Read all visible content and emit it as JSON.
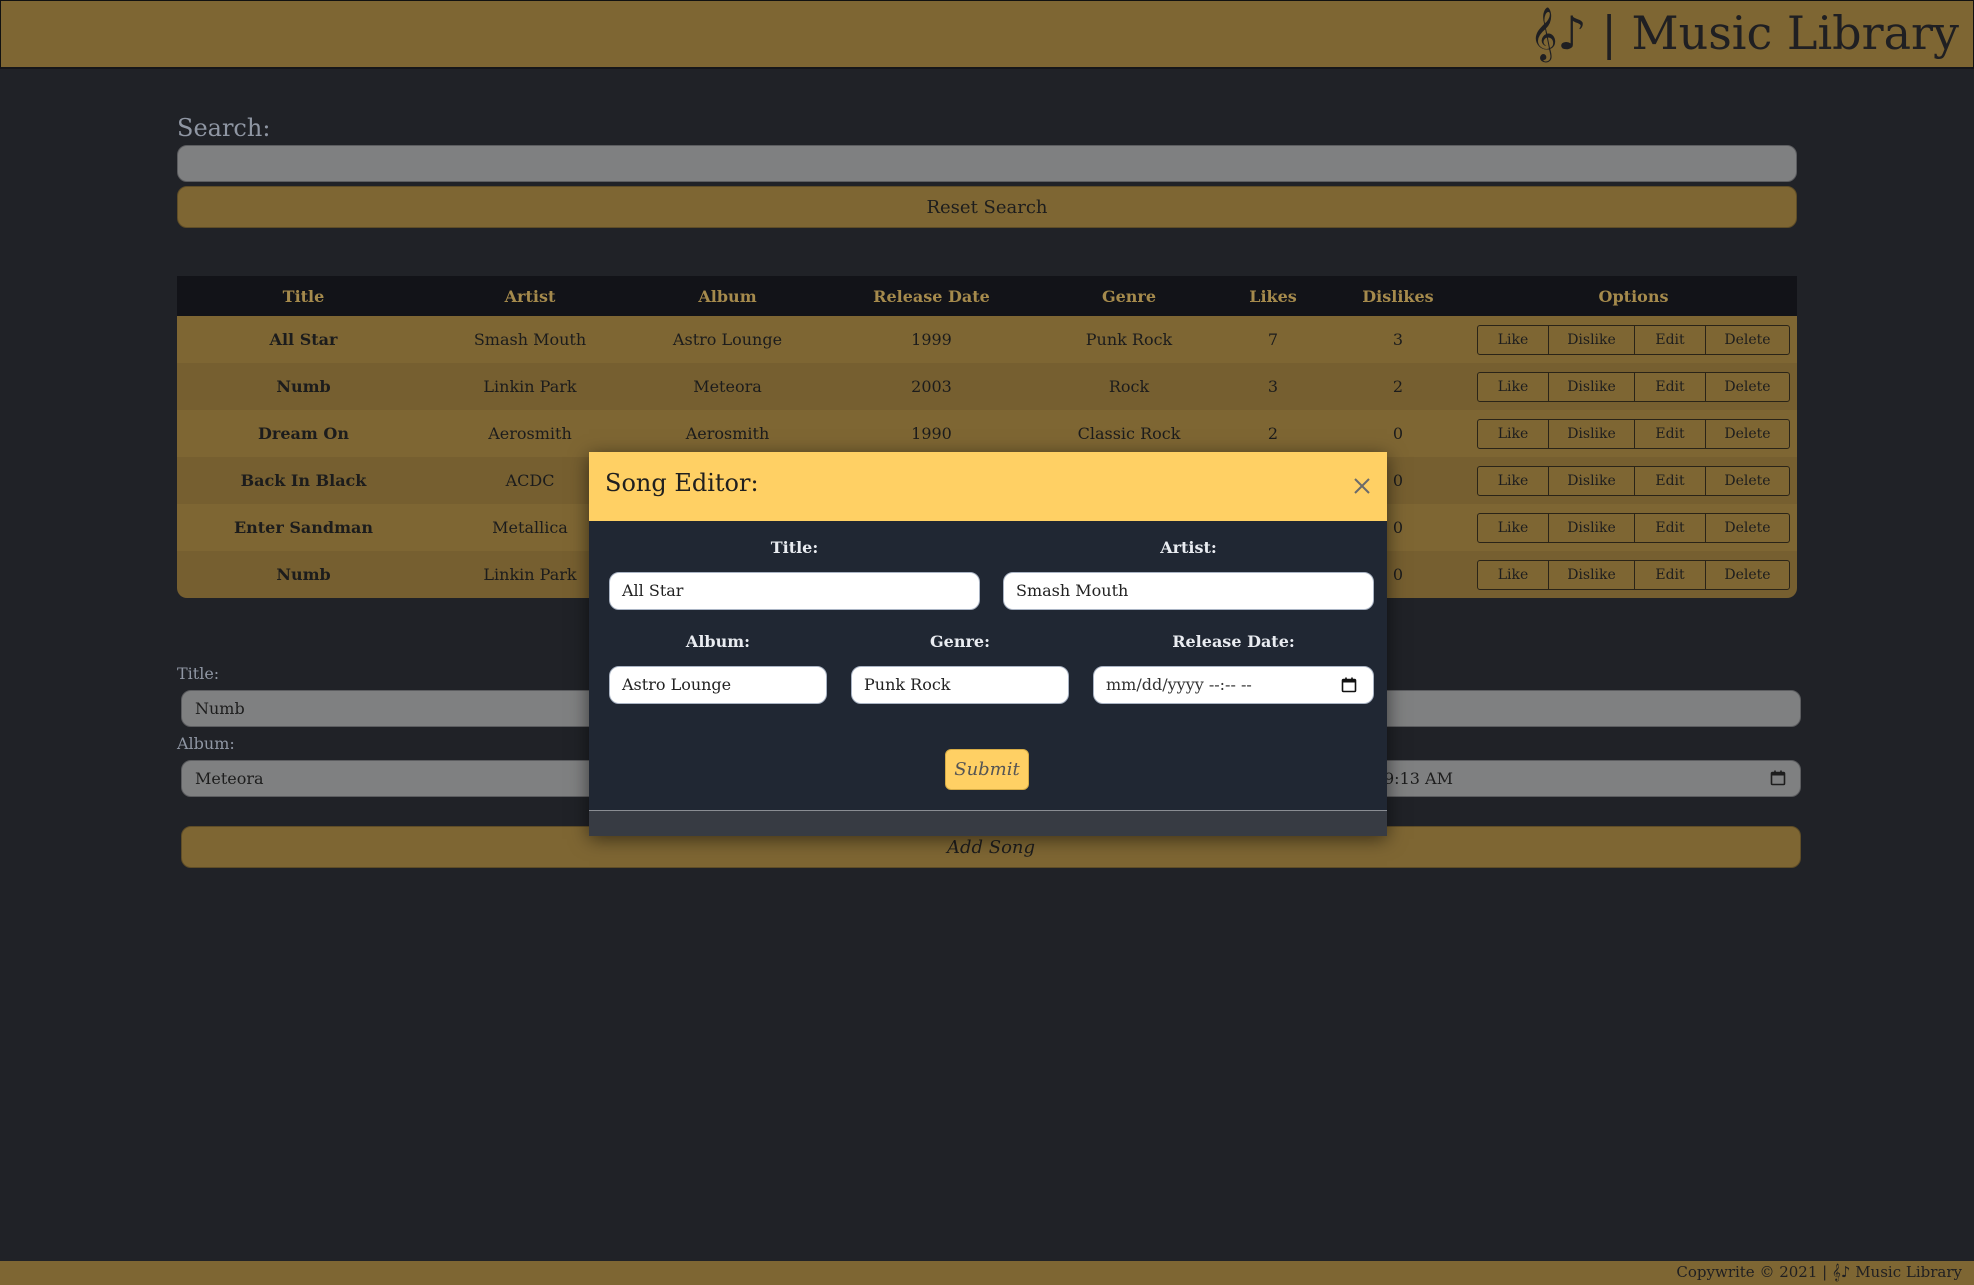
{
  "header": {
    "brand": "𝄞♪ | Music Library"
  },
  "search": {
    "label": "Search:",
    "value": "",
    "reset_label": "Reset Search"
  },
  "table": {
    "headers": [
      "Title",
      "Artist",
      "Album",
      "Release Date",
      "Genre",
      "Likes",
      "Dislikes",
      "Options"
    ],
    "option_labels": {
      "like": "Like",
      "dislike": "Dislike",
      "edit": "Edit",
      "delete": "Delete"
    },
    "rows": [
      {
        "title": "All Star",
        "artist": "Smash Mouth",
        "album": "Astro Lounge",
        "release_date": "1999",
        "genre": "Punk Rock",
        "likes": "7",
        "dislikes": "3"
      },
      {
        "title": "Numb",
        "artist": "Linkin Park",
        "album": "Meteora",
        "release_date": "2003",
        "genre": "Rock",
        "likes": "3",
        "dislikes": "2"
      },
      {
        "title": "Dream On",
        "artist": "Aerosmith",
        "album": "Aerosmith",
        "release_date": "1990",
        "genre": "Classic Rock",
        "likes": "2",
        "dislikes": "0"
      },
      {
        "title": "Back In Black",
        "artist": "ACDC",
        "album": "",
        "release_date": "",
        "genre": "",
        "likes": "",
        "dislikes": "0"
      },
      {
        "title": "Enter Sandman",
        "artist": "Metallica",
        "album": "",
        "release_date": "",
        "genre": "",
        "likes": "",
        "dislikes": "0"
      },
      {
        "title": "Numb",
        "artist": "Linkin Park",
        "album": "",
        "release_date": "",
        "genre": "",
        "likes": "",
        "dislikes": "0"
      }
    ]
  },
  "add_form": {
    "title_label": "Title:",
    "title_value": "Numb",
    "album_label": "Album:",
    "album_value": "Meteora",
    "release_visible": "9:13 AM",
    "add_label": "Add Song"
  },
  "modal": {
    "title": "Song Editor:",
    "close_icon": "close-icon",
    "fields": {
      "title_label": "Title:",
      "title_value": "All Star",
      "artist_label": "Artist:",
      "artist_value": "Smash Mouth",
      "album_label": "Album:",
      "album_value": "Astro Lounge",
      "genre_label": "Genre:",
      "genre_value": "Punk Rock",
      "release_label": "Release Date:",
      "release_placeholder": "mm/dd/yyyy --:-- --"
    },
    "submit_label": "Submit"
  },
  "footer": {
    "text": "Copywrite © 2021 | 𝄞♪ Music Library"
  },
  "colors": {
    "background": "#202227",
    "gold": "#7e6633",
    "modal_header": "#ffd064",
    "modal_body": "#202733",
    "table_header": "#121318"
  }
}
